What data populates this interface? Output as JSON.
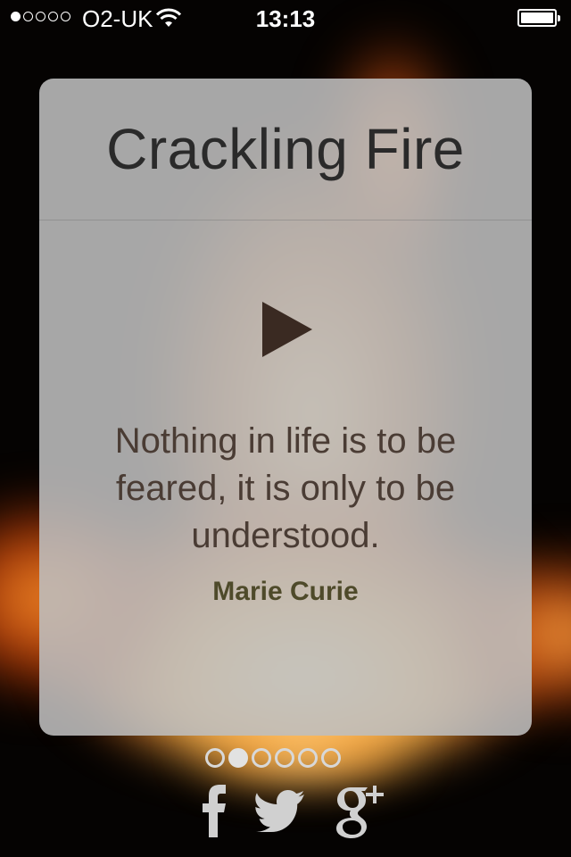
{
  "status_bar": {
    "signal_bars_filled": 1,
    "signal_bars_total": 5,
    "carrier": "O2-UK",
    "time": "13:13",
    "battery_percent": 100
  },
  "card": {
    "title": "Crackling Fire",
    "quote": "Nothing in life is to be feared, it is only to be understood.",
    "author": "Marie Curie",
    "play_icon": "play-icon"
  },
  "pager": {
    "total_pages": 6,
    "current_page": 2
  },
  "social": {
    "icons": [
      "facebook-icon",
      "twitter-icon",
      "google-plus-icon"
    ]
  }
}
